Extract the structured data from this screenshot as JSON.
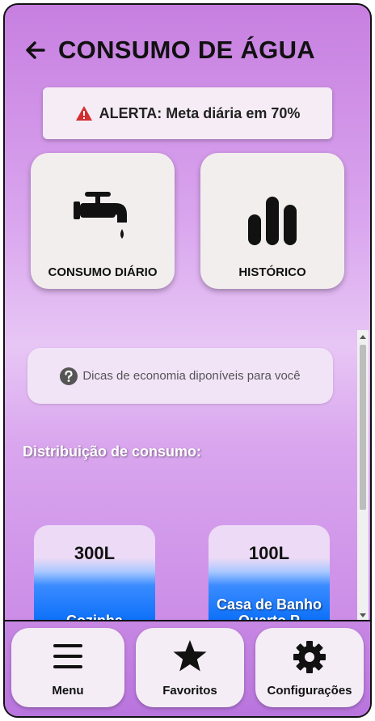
{
  "header": {
    "title": "CONSUMO DE ÁGUA",
    "back_icon": "arrow-left-icon"
  },
  "alert": {
    "text": "ALERTA: Meta diária em 70%",
    "icon": "warning-icon",
    "icon_color": "#d32f2f"
  },
  "tiles": [
    {
      "label": "CONSUMO DIÁRIO",
      "icon": "faucet-icon"
    },
    {
      "label": "HISTÓRICO",
      "icon": "bar-chart-icon"
    }
  ],
  "tips": {
    "text": "Dicas de economia diponíveis para você",
    "icon": "help-circle-icon"
  },
  "distribution": {
    "title": "Distribuição de consumo:",
    "bars": [
      {
        "value": "300L",
        "label": "Cozinha"
      },
      {
        "value": "100L",
        "label": "Casa de Banho Quarto P"
      }
    ]
  },
  "nav": [
    {
      "label": "Menu",
      "icon": "hamburger-icon"
    },
    {
      "label": "Favoritos",
      "icon": "star-icon"
    },
    {
      "label": "Configurações",
      "icon": "gear-icon"
    }
  ],
  "colors": {
    "water_blue": "#0a6ff8",
    "accent_purple": "#c77fe0"
  }
}
